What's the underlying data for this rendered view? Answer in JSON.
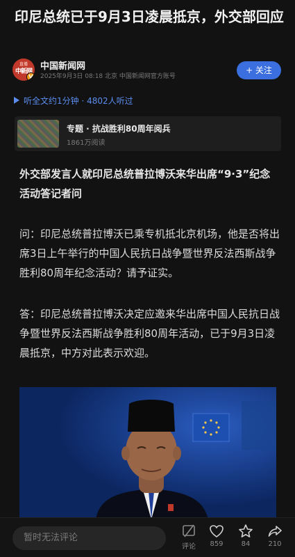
{
  "article": {
    "title": "印尼总统已于9月3日凌晨抵京，外交部回应",
    "subhead": "外交部发言人就印尼总统普拉博沃来华出席“9·3”纪念活动答记者问",
    "paragraphs": [
      "问：印尼总统普拉博沃已乘专机抵北京机场，他是否将出席3日上午举行的中国人民抗日战争暨世界反法西斯战争胜利80周年纪念活动？请予证实。",
      "答：印尼总统普拉博沃决定应邀来华出席中国人民抗日战争暨世界反法西斯战争胜利80周年活动，已于9月3日凌晨抵京，中方对此表示欢迎。"
    ]
  },
  "author": {
    "avatar_text_top": "直播",
    "avatar_text_main": "中新网",
    "avatar_badge": "V",
    "name": "中国新闻网",
    "meta": "2025年9月3日 08:18  北京  中国新闻网官方账号",
    "follow_label": "+ 关注"
  },
  "listen": {
    "label": "听全文约1分钟 · 4802人听过"
  },
  "topic": {
    "title": "专题 · 抗战胜利80周年阅兵",
    "reads": "1861万阅读"
  },
  "bottom_bar": {
    "comment_placeholder": "暂时无法评论",
    "comment_label": "评论",
    "likes": "859",
    "favorites": "84",
    "shares": "210"
  },
  "colors": {
    "accent": "#3b6fe0",
    "link": "#5b8def",
    "background": "#121212"
  }
}
